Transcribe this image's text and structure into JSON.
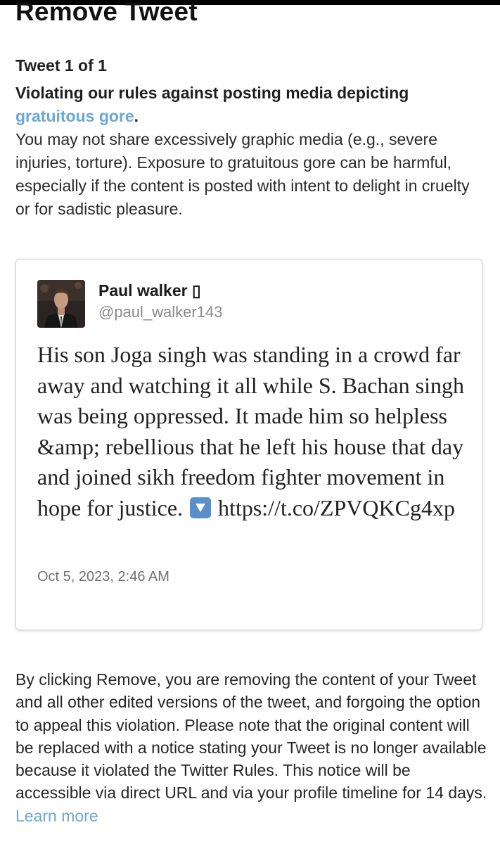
{
  "header": {
    "title": "Remove Tweet"
  },
  "tweet_counter": "Tweet 1 of 1",
  "violation": {
    "heading_prefix": "Violating our rules against posting media depicting ",
    "rule_link": "gratuitous gore",
    "heading_suffix": ".",
    "description": "You may not share excessively graphic media (e.g., severe injuries, torture). Exposure to gratuitous gore can be harmful, especially if the content is posted with intent to delight in cruelty or for sadistic pleasure."
  },
  "tweet": {
    "author_name": "Paul walker ▯",
    "author_handle": "@paul_walker143",
    "text_before_icon": "His son Joga singh was standing in a crowd far away and watching it all while S. Bachan singh was being oppressed. It made him so helpless &amp; rebellious that he left his house that day and joined sikh freedom fighter movement in hope for justice. ",
    "icon": "down-arrow-button-icon",
    "text_after_icon": " https://t.co/ZPVQKCg4xp",
    "date": "Oct 5, 2023, 2:46 AM"
  },
  "notice": {
    "text": "By clicking Remove, you are removing the content of your Tweet and all other edited versions of the tweet, and forgoing the option to appeal this violation. Please note that the original content will be replaced with a notice stating your Tweet is no longer available because it violated the Twitter Rules. This notice will be accessible via direct URL and via your profile timeline for 14 days. ",
    "learn_more": "Learn more"
  },
  "colors": {
    "link": "#6aa7d8",
    "emoji_arrow_bg": "#5b8fc9"
  }
}
